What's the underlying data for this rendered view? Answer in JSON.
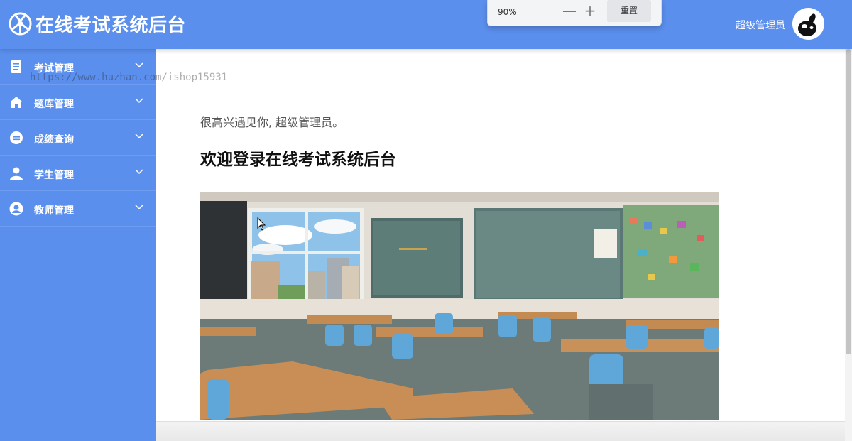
{
  "header": {
    "title": "在线考试系统后台",
    "user_name": "超级管理员",
    "bg_color": "#5b8fee"
  },
  "zoom": {
    "value": "90%",
    "minus": "—",
    "plus": "+",
    "reset": "重置"
  },
  "sidebar": {
    "items": [
      {
        "label": "考试管理",
        "icon": "document-icon"
      },
      {
        "label": "题库管理",
        "icon": "house-icon"
      },
      {
        "label": "成绩查询",
        "icon": "badge-icon"
      },
      {
        "label": "学生管理",
        "icon": "user-icon"
      },
      {
        "label": "教师管理",
        "icon": "teacher-icon"
      }
    ]
  },
  "watermark": "https://www.huzhan.com/ishop15931",
  "main": {
    "greeting": "很高兴遇见你, 超级管理员。",
    "welcome": "欢迎登录在线考试系统后台",
    "hero_image": "classroom-photo"
  }
}
